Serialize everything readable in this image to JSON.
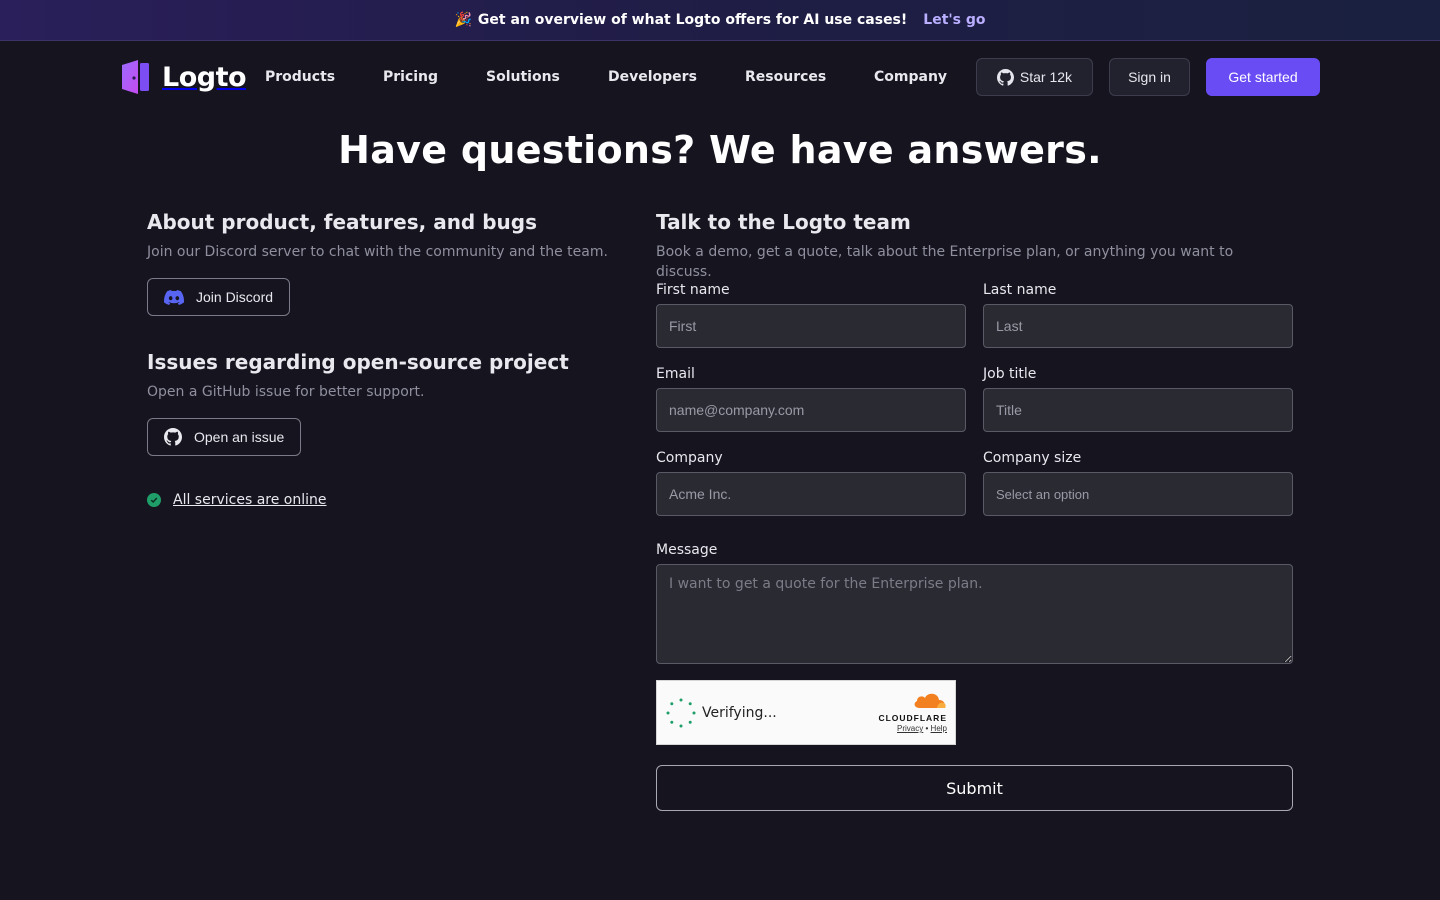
{
  "banner": {
    "emoji": "🎉",
    "text": "Get an overview of what Logto offers for AI use cases!",
    "cta": "Let's go"
  },
  "nav": {
    "brand": "Logto",
    "links": [
      "Products",
      "Pricing",
      "Solutions",
      "Developers",
      "Resources",
      "Company"
    ],
    "star_label": "Star 12k",
    "signin_label": "Sign in",
    "get_started_label": "Get started"
  },
  "page": {
    "title": "Have questions? We have answers."
  },
  "left": {
    "discord": {
      "title": "About product, features, and bugs",
      "desc": "Join our Discord server to chat with the community and the team.",
      "button": "Join Discord"
    },
    "github": {
      "title": "Issues regarding open-source project",
      "desc": "Open a GitHub issue for better support.",
      "button": "Open an issue"
    },
    "status": "All services are online"
  },
  "form": {
    "title": "Talk to the Logto team",
    "desc": "Book a demo, get a quote, talk about the Enterprise plan, or anything you want to discuss.",
    "first_name": {
      "label": "First name",
      "placeholder": "First"
    },
    "last_name": {
      "label": "Last name",
      "placeholder": "Last"
    },
    "email": {
      "label": "Email",
      "placeholder": "name@company.com"
    },
    "job_title": {
      "label": "Job title",
      "placeholder": "Title"
    },
    "company": {
      "label": "Company",
      "placeholder": "Acme Inc."
    },
    "company_size": {
      "label": "Company size",
      "placeholder": "Select an option"
    },
    "message": {
      "label": "Message",
      "placeholder": "I want to get a quote for the Enterprise plan."
    },
    "captcha": {
      "status": "Verifying...",
      "brand": "CLOUDFLARE",
      "privacy": "Privacy",
      "separator": "•",
      "help": "Help"
    },
    "submit": "Submit"
  },
  "colors": {
    "background": "#15141f",
    "accent": "#6a4cf5",
    "status_ok": "#1f9e6a",
    "discord": "#5865f2"
  }
}
